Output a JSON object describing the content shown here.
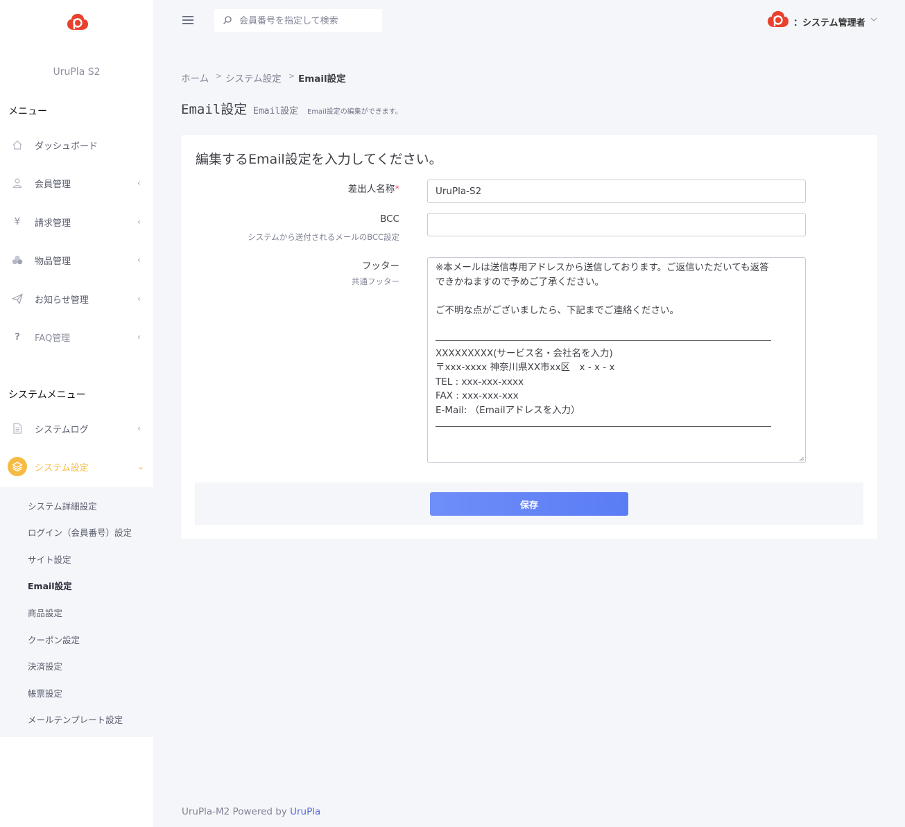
{
  "sidebar": {
    "brand": "UruPla S2",
    "menu_title": "メニュー",
    "items": [
      {
        "label": "ダッシュボード",
        "icon": "home-icon",
        "has_children": false
      },
      {
        "label": "会員管理",
        "icon": "user-icon",
        "has_children": true
      },
      {
        "label": "請求管理",
        "icon": "yen-icon",
        "has_children": true
      },
      {
        "label": "物品管理",
        "icon": "boxes-icon",
        "has_children": true
      },
      {
        "label": "お知らせ管理",
        "icon": "paper-plane-icon",
        "has_children": true
      },
      {
        "label": "FAQ管理",
        "icon": "question-icon",
        "has_children": true
      }
    ],
    "system_title": "システムメニュー",
    "system_items": [
      {
        "label": "システムログ",
        "icon": "document-icon",
        "has_children": true
      },
      {
        "label": "システム設定",
        "icon": "layers-icon",
        "has_children": true,
        "active": true
      }
    ],
    "submenu": [
      "システム詳細設定",
      "ログイン（会員番号）設定",
      "サイト設定",
      "Email設定",
      "商品設定",
      "クーポン設定",
      "決済設定",
      "帳票設定",
      "メールテンプレート設定"
    ],
    "active_color": "#f6bb42"
  },
  "header": {
    "search_placeholder": "会員番号を指定して検索",
    "user_label": "：システム管理者"
  },
  "breadcrumb": [
    "ホーム",
    "システム設定",
    "Email設定"
  ],
  "page": {
    "title": "Email設定",
    "subtitle": "Email設定",
    "description": "Email設定の編集ができます。"
  },
  "form": {
    "heading": "編集するEmail設定を入力してください。",
    "sender_label": "差出人名称",
    "sender_required_mark": "*",
    "sender_value": "UruPla-S2",
    "bcc_label": "BCC",
    "bcc_help": "システムから送付されるメールのBCC設定",
    "bcc_value": "",
    "footer_label": "フッター",
    "footer_help": "共通フッター",
    "footer_lines": [
      "※本メールは送信専用アドレスから送信しております。ご返信いただいても返答",
      "できかねますので予めご了承ください。",
      "",
      "ご不明な点がございましたら、下記までご連絡ください。",
      "",
      "---",
      "XXXXXXXXX(サービス名・会社名を入力)",
      "〒xxx-xxxx 神奈川県XX市xx区　x - x - x",
      "TEL : xxx-xxx-xxxx",
      "FAX : xxx-xxx-xxx",
      "E-Mail: （Emailアドレスを入力）",
      "---"
    ],
    "save_label": "保存",
    "accent_color": "#5a7cf5"
  },
  "footer": {
    "prefix": "UruPla-M2 Powered by ",
    "link": "UruPla"
  }
}
